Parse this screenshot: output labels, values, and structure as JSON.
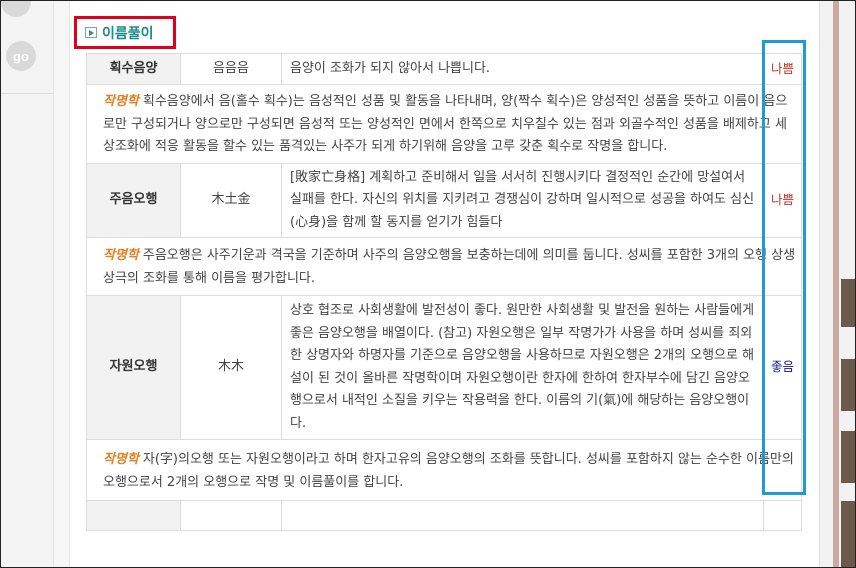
{
  "side": {
    "go_label": "go"
  },
  "section": {
    "title": "이름풀이"
  },
  "rows": [
    {
      "label": "획수음양",
      "value": "음음음",
      "desc": "음양이 조화가 되지 않아서 나쁩니다.",
      "verdict": "나쁨"
    },
    {
      "note_title": "작명학",
      "note": "획수음양에서 음(홀수 획수)는 음성적인 성품 및 활동을 나타내며, 양(짝수 획수)은 양성적인 성품을 뜻하고 이름이 음으로만 구성되거나 양으로만 구성되면 음성적 또는 양성적인 면에서 한쪽으로 치우칠수 있는 점과 외골수적인 성품을 배제하고 세상조화에 적응 활동을 할수 있는 품격있는 사주가 되게 하기위해 음양을 고루 갖춘 획수로 작명을 합니다."
    },
    {
      "label": "주음오행",
      "value": "木土金",
      "desc": "[敗家亡身格] 계획하고 준비해서 일을 서서히 진행시키다 결정적인 순간에 망설여서 실패를 한다. 자신의 위치를 지키려고 경쟁심이 강하며 일시적으로 성공을 하여도 심신(心身)을 함께 할 동지를 얻기가 힘들다",
      "verdict": "나쁨"
    },
    {
      "note_title": "작명학",
      "note": "주음오행은 사주기운과 격국을 기준하며 사주의 음양오행을 보충하는데에 의미를 둡니다. 성씨를 포함한 3개의 오행 상생 상극의 조화를 통해 이름을 평가합니다."
    },
    {
      "label": "자원오행",
      "value": "木木",
      "desc": "상호 협조로 사회생활에 발전성이 좋다. 원만한 사회생활 및 발전을 원하는 사람들에게 좋은 음양오행을 배열이다. (참고) 자원오행은 일부 작명가가 사용을 하며 성씨를 죄외한 상명자와 하명자를 기준으로 음양오행을 사용하므로 자원오행은 2개의 오행으로 해설이 된 것이 올바른 작명학이며 자원오행이란 한자에 한하여 한자부수에 담긴 음양오행으로서 내적인 소질을 키우는 작용력을 한다. 이름의 기(氣)에 해당하는 음양오행이다.",
      "verdict": "좋음"
    },
    {
      "note_title": "작명학",
      "note": "자(字)의오행 또는 자원오행이라고 하며 한자고유의 음양오행의 조화를 뜻합니다. 성씨를 포함하지 않는 순수한 이름만의 오행으로서 2개의 오행으로 작명 및 이름풀이를 합니다."
    }
  ]
}
